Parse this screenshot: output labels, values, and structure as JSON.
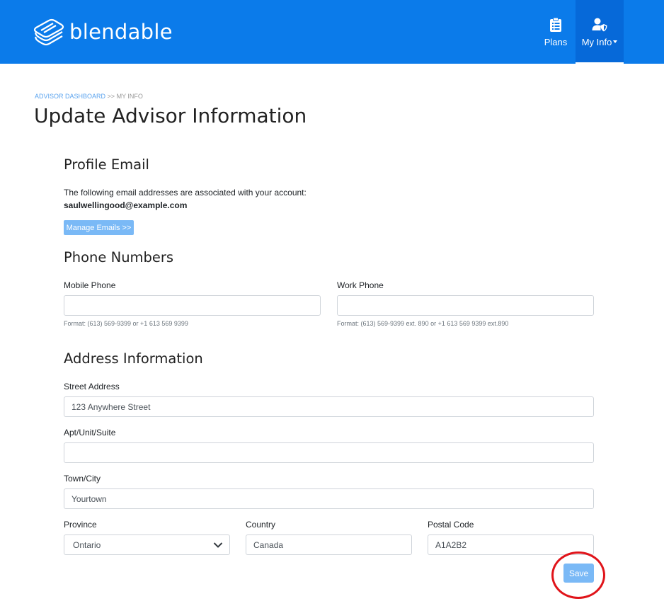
{
  "brand": {
    "name": "blendable"
  },
  "nav": {
    "plans_label": "Plans",
    "myinfo_label": "My Info"
  },
  "breadcrumb": {
    "parent": "ADVISOR DASHBOARD",
    "separator": ">>",
    "current": "MY INFO"
  },
  "page": {
    "title": "Update Advisor Information"
  },
  "profile_email": {
    "heading": "Profile Email",
    "description": "The following email addresses are associated with your account:",
    "email": "saulwellingood@example.com",
    "manage_button": "Manage Emails >>"
  },
  "phone": {
    "heading": "Phone Numbers",
    "mobile_label": "Mobile Phone",
    "mobile_value": "",
    "mobile_hint": "Format: (613) 569-9399 or +1 613 569 9399",
    "work_label": "Work Phone",
    "work_value": "",
    "work_hint": "Format: (613) 569-9399 ext. 890 or +1 613 569 9399 ext.890"
  },
  "address": {
    "heading": "Address Information",
    "street_label": "Street Address",
    "street_value": "123 Anywhere Street",
    "apt_label": "Apt/Unit/Suite",
    "apt_value": "",
    "city_label": "Town/City",
    "city_value": "Yourtown",
    "province_label": "Province",
    "province_value": "Ontario",
    "country_label": "Country",
    "country_value": "Canada",
    "postal_label": "Postal Code",
    "postal_value": "A1A2B2"
  },
  "actions": {
    "save_label": "Save"
  },
  "colors": {
    "nav_bg": "#0b7bea",
    "nav_active_bg": "#0669d9",
    "button_bg": "#7ab9f6",
    "highlight": "#e0141a"
  }
}
